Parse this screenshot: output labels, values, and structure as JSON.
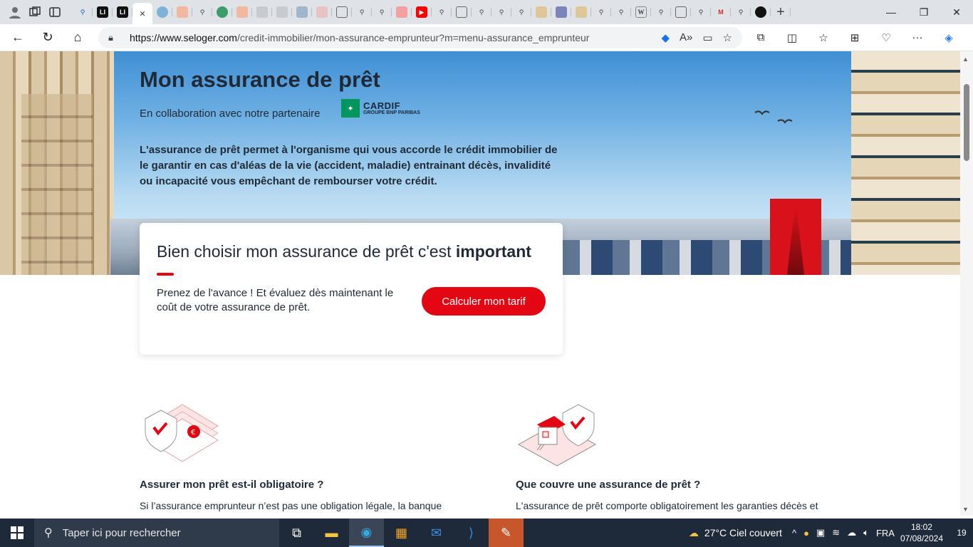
{
  "browser": {
    "tab_labels": [
      "LI",
      "LI"
    ],
    "url_host": "https://www.seloger.com",
    "url_path": "/credit-immobilier/mon-assurance-emprunteur?m=menu-assurance_emprunteur"
  },
  "hero": {
    "title": "Mon assurance de prêt",
    "partner_text": "En collaboration avec notre partenaire",
    "partner_name": "CARDIF",
    "partner_sub": "GROUPE BNP PARIBAS",
    "description": "L'assurance de prêt permet à l'organisme qui vous accorde le crédit immobilier de le garantir en cas d'aléas de la vie (accident, maladie) entrainant décès, invalidité ou incapacité vous empêchant de rembourser votre crédit."
  },
  "card": {
    "title_prefix": "Bien choisir mon assurance de prêt c'est ",
    "title_bold": "important",
    "text": "Prenez de l'avance ! Et évaluez dès maintenant le coût de votre assurance de prêt.",
    "button": "Calculer mon tarif"
  },
  "features": [
    {
      "title": "Assurer mon prêt est-il obligatoire ?",
      "text": "Si l’assurance emprunteur n’est pas une obligation légale, la banque"
    },
    {
      "title": "Que couvre une assurance de prêt ?",
      "text": "L'assurance de prêt comporte obligatoirement les garanties décès et"
    }
  ],
  "taskbar": {
    "search_placeholder": "Taper ici pour rechercher",
    "weather": "27°C  Ciel couvert",
    "language": "FRA",
    "time": "18:02",
    "date": "07/08/2024",
    "notifications": "19"
  },
  "colors": {
    "accent": "#e30613",
    "text": "#1f2a36",
    "cardif_green": "#00965e"
  }
}
